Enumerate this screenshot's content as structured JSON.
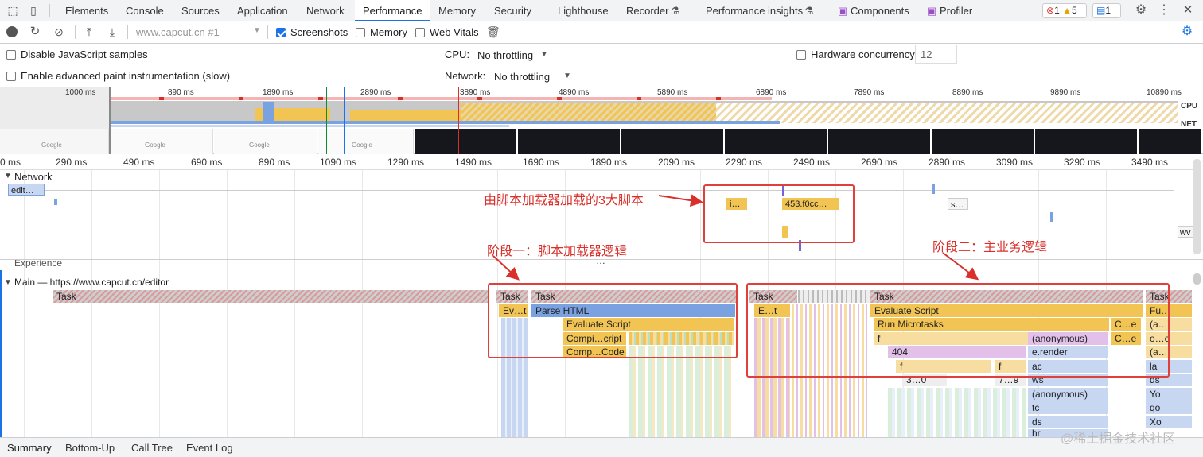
{
  "tabs": [
    "Elements",
    "Console",
    "Sources",
    "Application",
    "Network",
    "Performance",
    "Memory",
    "Security",
    "Lighthouse",
    "Recorder",
    "Performance insights",
    "Components",
    "Profiler"
  ],
  "badges": {
    "errors": "1",
    "warnings": "5",
    "messages": "1"
  },
  "toolbar": {
    "url": "www.capcut.cn #1",
    "screenshots": "Screenshots",
    "memory": "Memory",
    "web_vitals": "Web Vitals"
  },
  "settings": {
    "disable_js": "Disable JavaScript samples",
    "advanced_paint": "Enable advanced paint instrumentation (slow)",
    "cpu_label": "CPU:",
    "cpu_value": "No throttling",
    "network_label": "Network:",
    "network_value": "No throttling",
    "hw_label": "Hardware concurrency",
    "hw_value": "12"
  },
  "overview_ticks": [
    "1000 ms",
    "890 ms",
    "1890 ms",
    "2890 ms",
    "3890 ms",
    "4890 ms",
    "5890 ms",
    "6890 ms",
    "7890 ms",
    "8890 ms",
    "9890 ms",
    "10890 ms"
  ],
  "overview_labels": {
    "cpu": "CPU",
    "net": "NET",
    "google": "Google"
  },
  "ruler": [
    "0 ms",
    "290 ms",
    "490 ms",
    "690 ms",
    "890 ms",
    "1090 ms",
    "1290 ms",
    "1490 ms",
    "1690 ms",
    "1890 ms",
    "2090 ms",
    "2290 ms",
    "2490 ms",
    "2690 ms",
    "2890 ms",
    "3090 ms",
    "3290 ms",
    "3490 ms"
  ],
  "network": {
    "title": "Network",
    "req1": "edit…",
    "req2": "i…",
    "req3": "453.f0cc…",
    "req4": "s…",
    "req5": "wv"
  },
  "experience": "Experience",
  "main": {
    "title": "Main — https://www.capcut.cn/editor",
    "more": "…"
  },
  "flame": {
    "task": "Task",
    "evt": "Ev…t",
    "et": "E…t",
    "parse": "Parse HTML",
    "evalscript": "Evaluate Script",
    "compi": "Compi…cript",
    "compcode": "Comp…Code",
    "runmicro": "Run Microtasks",
    "ce": "C…e",
    "anon": "(anonymous)",
    "f": "f",
    "n404": "404",
    "erender": "e.render",
    "ac": "ac",
    "ws": "ws",
    "tc": "tc",
    "ds": "ds",
    "hr": "hr",
    "fu": "Fu…",
    "a1": "(a…)",
    "oe": "o…e",
    "la": "la",
    "yo": "Yo",
    "qo": "qo",
    "xo": "Xo",
    "n30": "3…0",
    "n79": "7…9"
  },
  "annotations": {
    "scripts": "由脚本加载器加载的3大脚本",
    "phase1": "阶段一：脚本加载器逻辑",
    "phase2": "阶段二：主业务逻辑"
  },
  "bottom_tabs": [
    "Summary",
    "Bottom-Up",
    "Call Tree",
    "Event Log"
  ],
  "watermark": "@稀土掘金技术社区"
}
